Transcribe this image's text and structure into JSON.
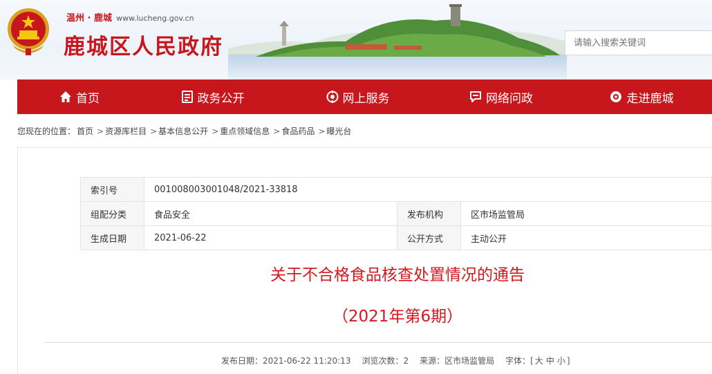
{
  "header": {
    "brand_top": "温州 · 鹿城",
    "url": "www.lucheng.gov.cn",
    "title": "鹿城区人民政府",
    "search_placeholder": "请输入搜索关键词"
  },
  "nav": [
    {
      "label": "首页",
      "icon": "home-icon"
    },
    {
      "label": "政务公开",
      "icon": "document-icon"
    },
    {
      "label": "网上服务",
      "icon": "service-icon"
    },
    {
      "label": "网络问政",
      "icon": "chat-icon"
    },
    {
      "label": "走进鹿城",
      "icon": "eye-icon"
    }
  ],
  "breadcrumb": {
    "prefix": "您现在的位置：",
    "items": [
      "首页",
      "资源库栏目",
      "基本信息公开",
      "重点领域信息",
      "食品药品",
      "曝光台"
    ],
    "separator": ">"
  },
  "meta": {
    "index_label": "索引号",
    "index_value": "001008003001048/2021-33818",
    "category_label": "组配分类",
    "category_value": "食品安全",
    "publisher_label": "发布机构",
    "publisher_value": "区市场监管局",
    "date_label": "生成日期",
    "date_value": "2021-06-22",
    "mode_label": "公开方式",
    "mode_value": "主动公开"
  },
  "doc": {
    "title": "关于不合格食品核查处置情况的通告",
    "subtitle": "（2021年第6期）"
  },
  "pubinfo": {
    "date": "发布日期：2021-06-22 11:20:13",
    "views": "浏览次数：2",
    "source": "来源：区市场监管局",
    "font_label": "字体：[",
    "font_large": "大",
    "font_medium": "中",
    "font_small": "小",
    "font_end": "]"
  },
  "colors": {
    "brand_red": "#c8161d",
    "title_red": "#d4181e"
  }
}
